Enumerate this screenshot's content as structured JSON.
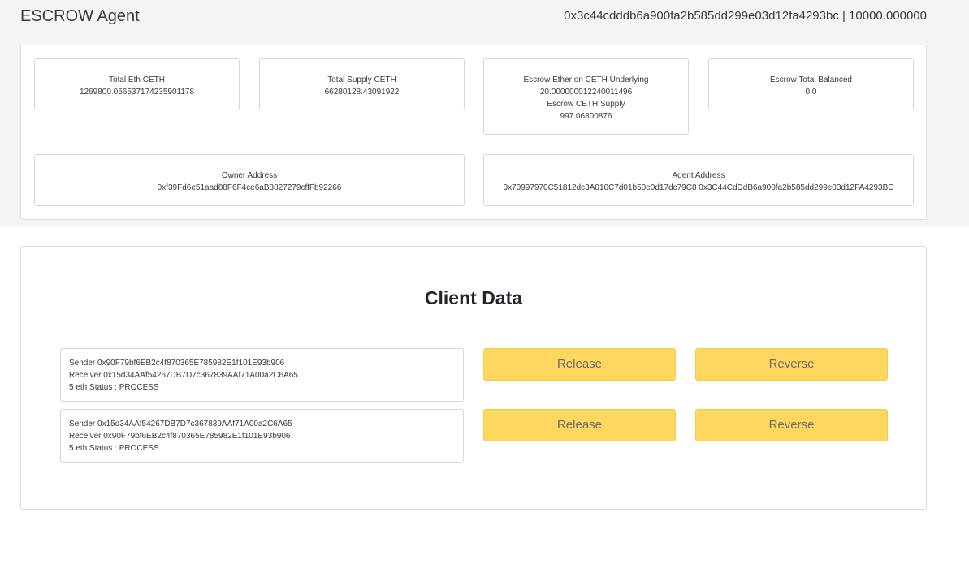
{
  "header": {
    "title": "ESCROW Agent",
    "account": "0x3c44cdddb6a900fa2b585dd299e03d12fa4293bc | 10000.000000"
  },
  "stats": {
    "total_eth": {
      "label": "Total Eth CETH",
      "value": "1269800.056537174235901178"
    },
    "total_supply": {
      "label": "Total Supply CETH",
      "value": "66280128.43091922"
    },
    "escrow_ether": {
      "label": "Escrow Ether on CETH Underlying",
      "value": "20.000000012240011496",
      "supply_label": "Escrow CETH Supply",
      "supply_value": "997.06800876"
    },
    "escrow_balanced": {
      "label": "Escrow Total Balanced",
      "value": "0.0"
    },
    "owner": {
      "label": "Owner Address",
      "value": "0xf39Fd6e51aad88F6F4ce6aB8827279cffFb92266"
    },
    "agent": {
      "label": "Agent Address",
      "value": "0x70997970C51812dc3A010C7d01b50e0d17dc79C8 0x3C44CdDdB6a900fa2b585dd299e03d12FA4293BC"
    }
  },
  "client": {
    "title": "Client Data",
    "transactions": [
      {
        "sender": "Sender 0x90F79bf6EB2c4f870365E785982E1f101E93b906",
        "receiver": "Receiver 0x15d34AAf54267DB7D7c367839AAf71A00a2C6A65",
        "status": "5 eth Status : PROCESS",
        "release_label": "Release",
        "reverse_label": "Reverse"
      },
      {
        "sender": "Sender 0x15d34AAf54267DB7D7c367839AAf71A00a2C6A65",
        "receiver": "Receiver 0x90F79bf6EB2c4f870365E785982E1f101E93b906",
        "status": "5 eth Status : PROCESS",
        "release_label": "Release",
        "reverse_label": "Reverse"
      }
    ]
  },
  "colors": {
    "button_bg": "#ffd75e",
    "page_band": "#f4f4f5"
  }
}
